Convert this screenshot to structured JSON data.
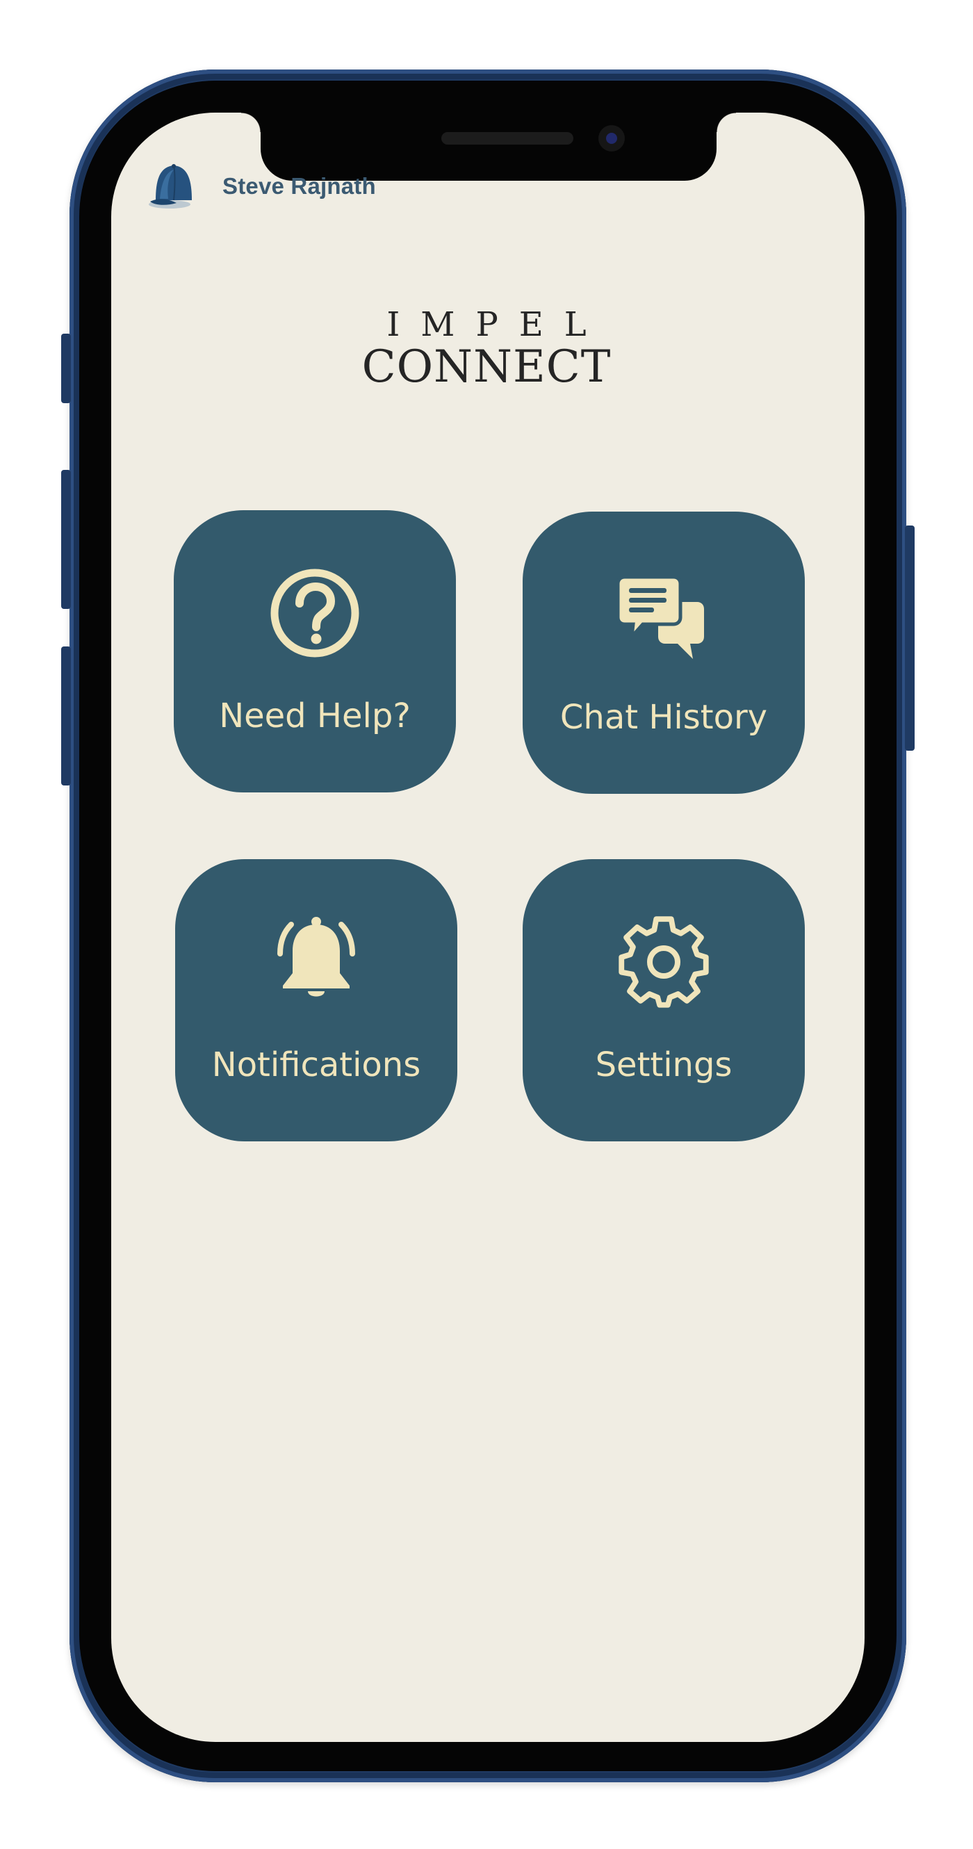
{
  "user": {
    "name": "Steve Rajnath",
    "avatar_icon": "baseball-cap-icon"
  },
  "logo": {
    "line1": "IMPEL",
    "line2": "CONNECT"
  },
  "tiles": [
    {
      "label": "Need Help?",
      "icon": "question-circle-icon"
    },
    {
      "label": "Chat History",
      "icon": "chat-bubbles-icon"
    },
    {
      "label": "Notifications",
      "icon": "bell-icon"
    },
    {
      "label": "Settings",
      "icon": "gear-icon"
    }
  ],
  "colors": {
    "background": "#f0ede3",
    "tile": "#335a6c",
    "tile_text": "#f0e5bb",
    "username": "#3b5a72",
    "phone_frame": "#1f3a63"
  }
}
